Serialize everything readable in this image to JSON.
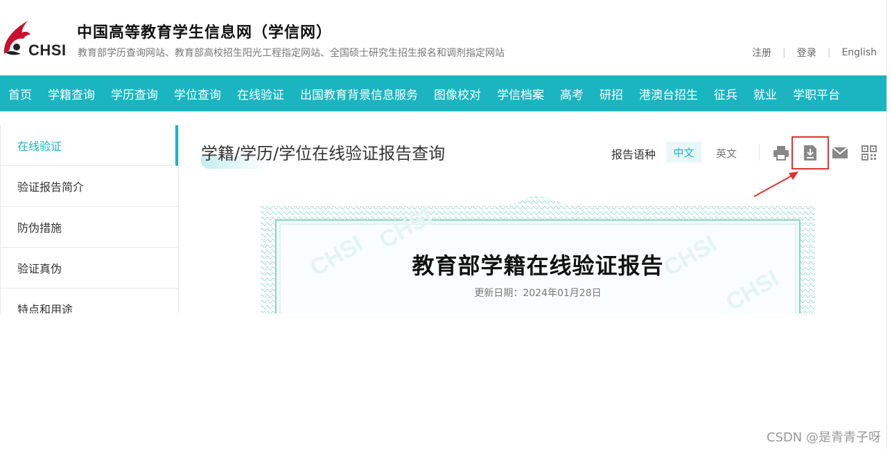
{
  "header": {
    "logo_text": "CHSI",
    "title": "中国高等教育学生信息网（学信网）",
    "subtitle": "教育部学历查询网站、教育部高校招生阳光工程指定网站、全国硕士研究生招生报名和调剂指定网站",
    "links": {
      "register": "注册",
      "login": "登录",
      "english": "English",
      "separator": "|"
    }
  },
  "nav": {
    "items": [
      "首页",
      "学籍查询",
      "学历查询",
      "学位查询",
      "在线验证",
      "出国教育背景信息服务",
      "图像校对",
      "学信档案",
      "高考",
      "研招",
      "港澳台招生",
      "征兵",
      "就业",
      "学职平台"
    ]
  },
  "sidebar": {
    "items": [
      "在线验证",
      "验证报告简介",
      "防伪措施",
      "验证真伪",
      "特点和用途"
    ],
    "active_index": 0
  },
  "main": {
    "page_title": "学籍/学历/学位在线验证报告查询",
    "lang_label": "报告语种",
    "lang_options": {
      "zh": "中文",
      "en": "英文"
    },
    "tools": {
      "print": "print-icon",
      "download": "download-icon",
      "mail": "mail-icon",
      "qrcode": "qrcode-icon"
    }
  },
  "certificate": {
    "title": "教育部学籍在线验证报告",
    "date": "更新日期：2024年01月28日"
  },
  "watermark": "CSDN @是青青子呀",
  "colors": {
    "accent": "#1ab5c0",
    "highlight": "#e03030",
    "cert_border": "#8fd3c4"
  }
}
